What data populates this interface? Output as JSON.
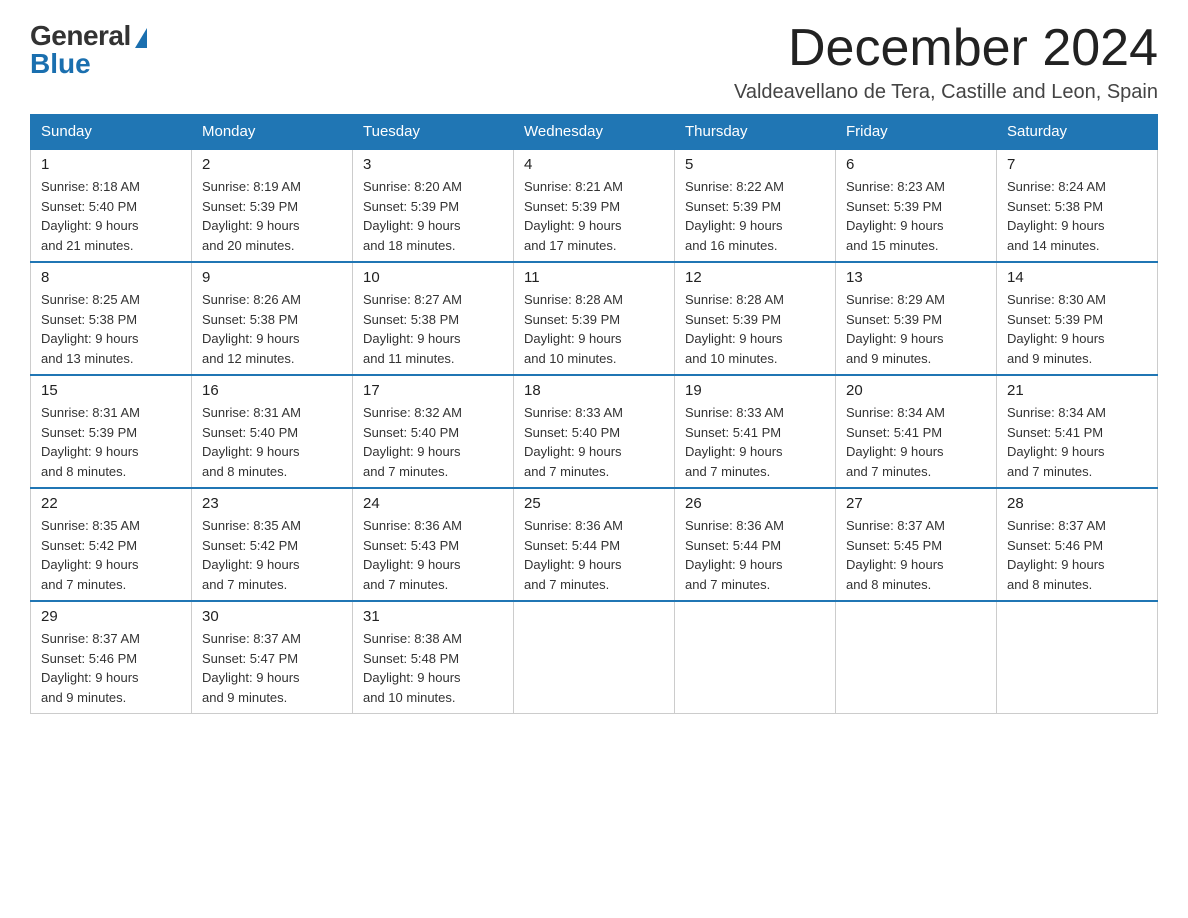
{
  "logo": {
    "general": "General",
    "blue": "Blue"
  },
  "header": {
    "month_year": "December 2024",
    "location": "Valdeavellano de Tera, Castille and Leon, Spain"
  },
  "days_of_week": [
    "Sunday",
    "Monday",
    "Tuesday",
    "Wednesday",
    "Thursday",
    "Friday",
    "Saturday"
  ],
  "weeks": [
    [
      {
        "day": "1",
        "sunrise": "8:18 AM",
        "sunset": "5:40 PM",
        "daylight": "9 hours and 21 minutes."
      },
      {
        "day": "2",
        "sunrise": "8:19 AM",
        "sunset": "5:39 PM",
        "daylight": "9 hours and 20 minutes."
      },
      {
        "day": "3",
        "sunrise": "8:20 AM",
        "sunset": "5:39 PM",
        "daylight": "9 hours and 18 minutes."
      },
      {
        "day": "4",
        "sunrise": "8:21 AM",
        "sunset": "5:39 PM",
        "daylight": "9 hours and 17 minutes."
      },
      {
        "day": "5",
        "sunrise": "8:22 AM",
        "sunset": "5:39 PM",
        "daylight": "9 hours and 16 minutes."
      },
      {
        "day": "6",
        "sunrise": "8:23 AM",
        "sunset": "5:39 PM",
        "daylight": "9 hours and 15 minutes."
      },
      {
        "day": "7",
        "sunrise": "8:24 AM",
        "sunset": "5:38 PM",
        "daylight": "9 hours and 14 minutes."
      }
    ],
    [
      {
        "day": "8",
        "sunrise": "8:25 AM",
        "sunset": "5:38 PM",
        "daylight": "9 hours and 13 minutes."
      },
      {
        "day": "9",
        "sunrise": "8:26 AM",
        "sunset": "5:38 PM",
        "daylight": "9 hours and 12 minutes."
      },
      {
        "day": "10",
        "sunrise": "8:27 AM",
        "sunset": "5:38 PM",
        "daylight": "9 hours and 11 minutes."
      },
      {
        "day": "11",
        "sunrise": "8:28 AM",
        "sunset": "5:39 PM",
        "daylight": "9 hours and 10 minutes."
      },
      {
        "day": "12",
        "sunrise": "8:28 AM",
        "sunset": "5:39 PM",
        "daylight": "9 hours and 10 minutes."
      },
      {
        "day": "13",
        "sunrise": "8:29 AM",
        "sunset": "5:39 PM",
        "daylight": "9 hours and 9 minutes."
      },
      {
        "day": "14",
        "sunrise": "8:30 AM",
        "sunset": "5:39 PM",
        "daylight": "9 hours and 9 minutes."
      }
    ],
    [
      {
        "day": "15",
        "sunrise": "8:31 AM",
        "sunset": "5:39 PM",
        "daylight": "9 hours and 8 minutes."
      },
      {
        "day": "16",
        "sunrise": "8:31 AM",
        "sunset": "5:40 PM",
        "daylight": "9 hours and 8 minutes."
      },
      {
        "day": "17",
        "sunrise": "8:32 AM",
        "sunset": "5:40 PM",
        "daylight": "9 hours and 7 minutes."
      },
      {
        "day": "18",
        "sunrise": "8:33 AM",
        "sunset": "5:40 PM",
        "daylight": "9 hours and 7 minutes."
      },
      {
        "day": "19",
        "sunrise": "8:33 AM",
        "sunset": "5:41 PM",
        "daylight": "9 hours and 7 minutes."
      },
      {
        "day": "20",
        "sunrise": "8:34 AM",
        "sunset": "5:41 PM",
        "daylight": "9 hours and 7 minutes."
      },
      {
        "day": "21",
        "sunrise": "8:34 AM",
        "sunset": "5:41 PM",
        "daylight": "9 hours and 7 minutes."
      }
    ],
    [
      {
        "day": "22",
        "sunrise": "8:35 AM",
        "sunset": "5:42 PM",
        "daylight": "9 hours and 7 minutes."
      },
      {
        "day": "23",
        "sunrise": "8:35 AM",
        "sunset": "5:42 PM",
        "daylight": "9 hours and 7 minutes."
      },
      {
        "day": "24",
        "sunrise": "8:36 AM",
        "sunset": "5:43 PM",
        "daylight": "9 hours and 7 minutes."
      },
      {
        "day": "25",
        "sunrise": "8:36 AM",
        "sunset": "5:44 PM",
        "daylight": "9 hours and 7 minutes."
      },
      {
        "day": "26",
        "sunrise": "8:36 AM",
        "sunset": "5:44 PM",
        "daylight": "9 hours and 7 minutes."
      },
      {
        "day": "27",
        "sunrise": "8:37 AM",
        "sunset": "5:45 PM",
        "daylight": "9 hours and 8 minutes."
      },
      {
        "day": "28",
        "sunrise": "8:37 AM",
        "sunset": "5:46 PM",
        "daylight": "9 hours and 8 minutes."
      }
    ],
    [
      {
        "day": "29",
        "sunrise": "8:37 AM",
        "sunset": "5:46 PM",
        "daylight": "9 hours and 9 minutes."
      },
      {
        "day": "30",
        "sunrise": "8:37 AM",
        "sunset": "5:47 PM",
        "daylight": "9 hours and 9 minutes."
      },
      {
        "day": "31",
        "sunrise": "8:38 AM",
        "sunset": "5:48 PM",
        "daylight": "9 hours and 10 minutes."
      },
      null,
      null,
      null,
      null
    ]
  ]
}
